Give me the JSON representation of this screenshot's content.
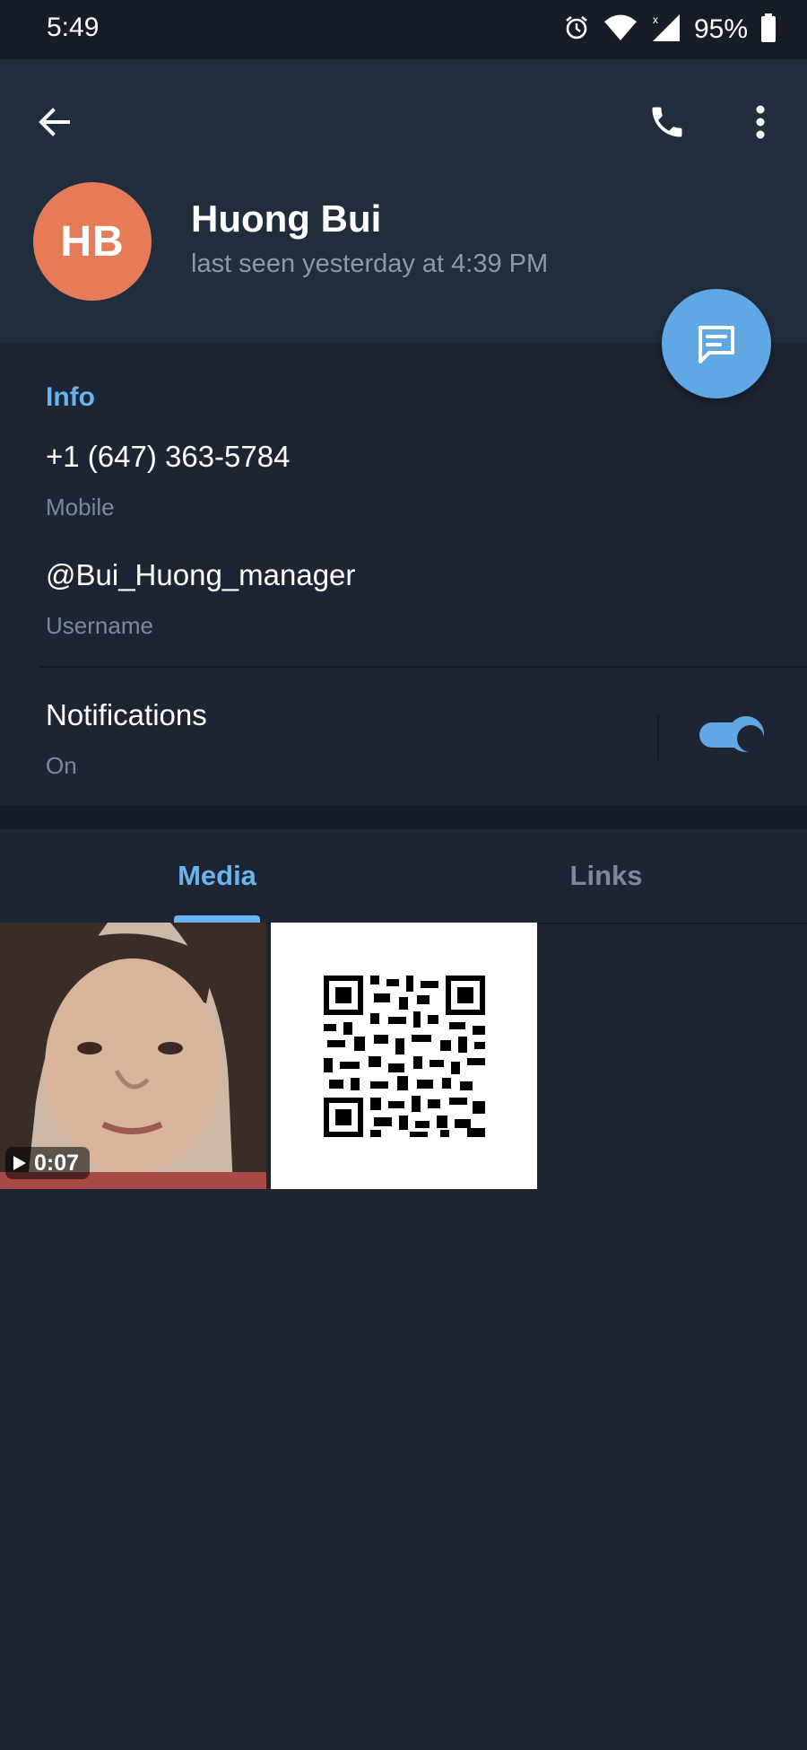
{
  "status_bar": {
    "time": "5:49",
    "battery_percent": "95%",
    "icons": [
      "alarm-icon",
      "wifi-icon",
      "signal-icon",
      "battery-icon"
    ]
  },
  "header": {
    "back_icon": "arrow-back-icon",
    "call_icon": "phone-icon",
    "menu_icon": "more-vertical-icon",
    "avatar_initials": "HB",
    "avatar_color": "#e57c57",
    "name": "Huong Bui",
    "status": "last seen yesterday at 4:39 PM"
  },
  "fab": {
    "icon": "message-icon",
    "color": "#5fa8e4"
  },
  "info": {
    "title": "Info",
    "phone": "+1 (647) 363-5784",
    "phone_label": "Mobile",
    "username": "@Bui_Huong_manager",
    "username_label": "Username",
    "notifications": "Notifications",
    "notifications_state": "On",
    "notifications_enabled": true
  },
  "tabs": [
    {
      "label": "Media",
      "active": true
    },
    {
      "label": "Links",
      "active": false
    }
  ],
  "media": [
    {
      "type": "video",
      "duration": "0:07"
    },
    {
      "type": "image",
      "subject": "qr-code"
    }
  ],
  "colors": {
    "accent": "#6ab3ee",
    "background": "#1d2533",
    "header": "#212d3b"
  }
}
